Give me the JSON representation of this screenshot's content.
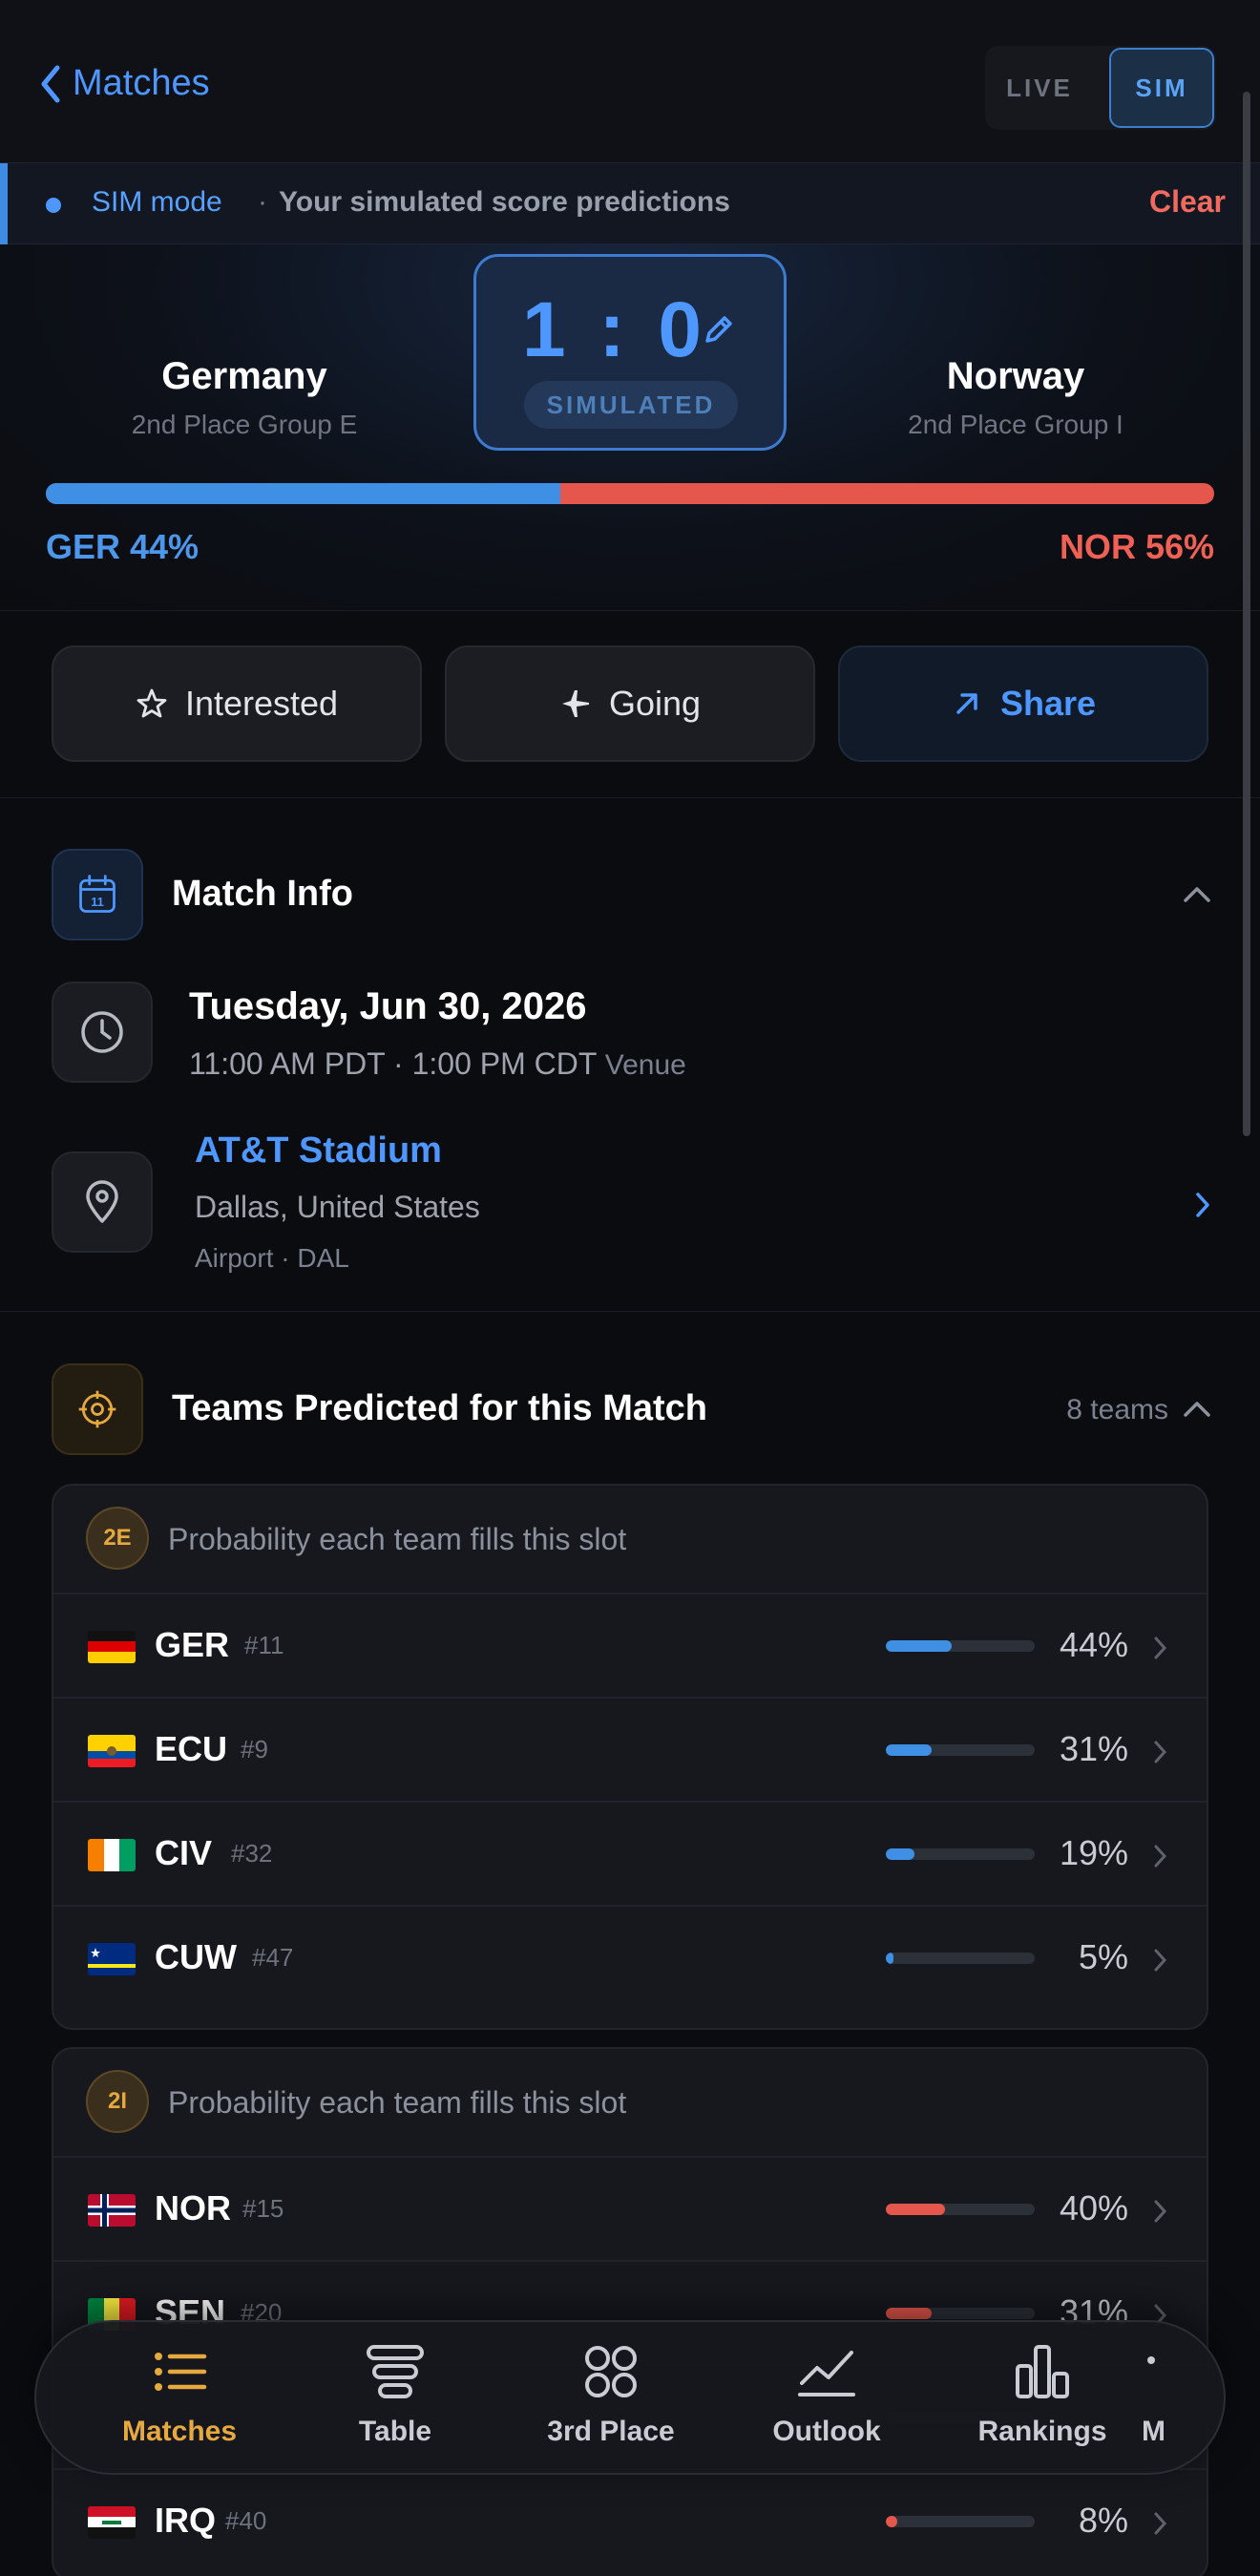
{
  "header": {
    "back_label": "Matches",
    "modes": [
      "LIVE",
      "SIM"
    ],
    "active_mode": "SIM"
  },
  "sim_banner": {
    "label": "SIM mode",
    "separator": "·",
    "description": "Your simulated score predictions",
    "clear_label": "Clear"
  },
  "match": {
    "home": {
      "name": "Germany",
      "slot": "2nd Place Group E",
      "code": "GER",
      "prob_label": "GER 44%",
      "prob": 0.44
    },
    "away": {
      "name": "Norway",
      "slot": "2nd Place Group I",
      "code": "NOR",
      "prob_label": "NOR 56%",
      "prob": 0.56
    },
    "score": "1 : 0",
    "score_badge": "SIMULATED"
  },
  "actions": {
    "interested": "Interested",
    "going": "Going",
    "share": "Share"
  },
  "match_info": {
    "title": "Match Info",
    "calendar_day": "11",
    "date": "Tuesday, Jun 30, 2026",
    "times": "11:00 AM PDT · 1:00 PM CDT",
    "venue_word": "Venue",
    "venue_name": "AT&T Stadium",
    "venue_city": "Dallas, United States",
    "venue_airport": "Airport · DAL"
  },
  "predicted": {
    "title": "Teams Predicted for this Match",
    "count_label": "8 teams",
    "slots": [
      {
        "slot": "2E",
        "caption": "Probability each team fills this slot",
        "teams": [
          {
            "code": "GER",
            "rank": "#11",
            "pct_label": "44%",
            "pct": 44,
            "color": "#3f8fe4"
          },
          {
            "code": "ECU",
            "rank": "#9",
            "pct_label": "31%",
            "pct": 31,
            "color": "#3f8fe4"
          },
          {
            "code": "CIV",
            "rank": "#32",
            "pct_label": "19%",
            "pct": 19,
            "color": "#3f8fe4"
          },
          {
            "code": "CUW",
            "rank": "#47",
            "pct_label": "5%",
            "pct": 5,
            "color": "#3f8fe4"
          }
        ]
      },
      {
        "slot": "2I",
        "caption": "Probability each team fills this slot",
        "teams": [
          {
            "code": "NOR",
            "rank": "#15",
            "pct_label": "40%",
            "pct": 40,
            "color": "#e5574c"
          },
          {
            "code": "SEN",
            "rank": "#20",
            "pct_label": "31%",
            "pct": 31,
            "color": "#e5574c"
          },
          {
            "code": "",
            "rank": "",
            "pct_label": "",
            "pct": 0,
            "color": "#e5574c"
          },
          {
            "code": "IRQ",
            "rank": "#40",
            "pct_label": "8%",
            "pct": 8,
            "color": "#e5574c"
          }
        ]
      }
    ]
  },
  "bottom_nav": {
    "items": [
      {
        "label": "Matches",
        "icon": "list-icon",
        "active": true
      },
      {
        "label": "Table",
        "icon": "table-icon",
        "active": false
      },
      {
        "label": "3rd Place",
        "icon": "grid-circles-icon",
        "active": false
      },
      {
        "label": "Outlook",
        "icon": "line-chart-icon",
        "active": false
      },
      {
        "label": "Rankings",
        "icon": "bar-chart-icon",
        "active": false
      },
      {
        "label": "M",
        "icon": "more-icon",
        "active": false
      }
    ]
  },
  "colors": {
    "accent_blue": "#4e97ff",
    "accent_red": "#e5574c",
    "accent_gold": "#e5a93f",
    "background": "#0b0c10"
  }
}
